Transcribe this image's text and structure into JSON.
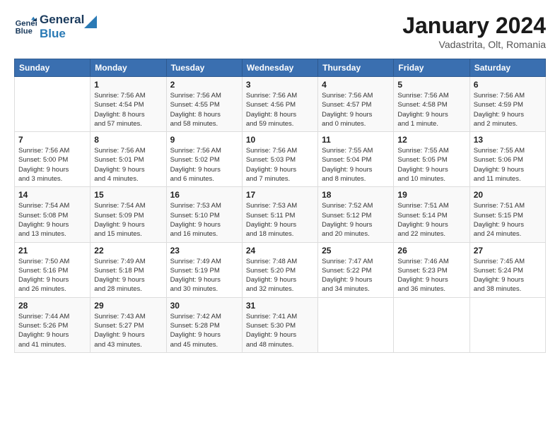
{
  "logo": {
    "line1": "General",
    "line2": "Blue"
  },
  "title": "January 2024",
  "subtitle": "Vadastrita, Olt, Romania",
  "header": {
    "days": [
      "Sunday",
      "Monday",
      "Tuesday",
      "Wednesday",
      "Thursday",
      "Friday",
      "Saturday"
    ]
  },
  "weeks": [
    [
      {
        "day": "",
        "info": ""
      },
      {
        "day": "1",
        "info": "Sunrise: 7:56 AM\nSunset: 4:54 PM\nDaylight: 8 hours\nand 57 minutes."
      },
      {
        "day": "2",
        "info": "Sunrise: 7:56 AM\nSunset: 4:55 PM\nDaylight: 8 hours\nand 58 minutes."
      },
      {
        "day": "3",
        "info": "Sunrise: 7:56 AM\nSunset: 4:56 PM\nDaylight: 8 hours\nand 59 minutes."
      },
      {
        "day": "4",
        "info": "Sunrise: 7:56 AM\nSunset: 4:57 PM\nDaylight: 9 hours\nand 0 minutes."
      },
      {
        "day": "5",
        "info": "Sunrise: 7:56 AM\nSunset: 4:58 PM\nDaylight: 9 hours\nand 1 minute."
      },
      {
        "day": "6",
        "info": "Sunrise: 7:56 AM\nSunset: 4:59 PM\nDaylight: 9 hours\nand 2 minutes."
      }
    ],
    [
      {
        "day": "7",
        "info": "Sunrise: 7:56 AM\nSunset: 5:00 PM\nDaylight: 9 hours\nand 3 minutes."
      },
      {
        "day": "8",
        "info": "Sunrise: 7:56 AM\nSunset: 5:01 PM\nDaylight: 9 hours\nand 4 minutes."
      },
      {
        "day": "9",
        "info": "Sunrise: 7:56 AM\nSunset: 5:02 PM\nDaylight: 9 hours\nand 6 minutes."
      },
      {
        "day": "10",
        "info": "Sunrise: 7:56 AM\nSunset: 5:03 PM\nDaylight: 9 hours\nand 7 minutes."
      },
      {
        "day": "11",
        "info": "Sunrise: 7:55 AM\nSunset: 5:04 PM\nDaylight: 9 hours\nand 8 minutes."
      },
      {
        "day": "12",
        "info": "Sunrise: 7:55 AM\nSunset: 5:05 PM\nDaylight: 9 hours\nand 10 minutes."
      },
      {
        "day": "13",
        "info": "Sunrise: 7:55 AM\nSunset: 5:06 PM\nDaylight: 9 hours\nand 11 minutes."
      }
    ],
    [
      {
        "day": "14",
        "info": "Sunrise: 7:54 AM\nSunset: 5:08 PM\nDaylight: 9 hours\nand 13 minutes."
      },
      {
        "day": "15",
        "info": "Sunrise: 7:54 AM\nSunset: 5:09 PM\nDaylight: 9 hours\nand 15 minutes."
      },
      {
        "day": "16",
        "info": "Sunrise: 7:53 AM\nSunset: 5:10 PM\nDaylight: 9 hours\nand 16 minutes."
      },
      {
        "day": "17",
        "info": "Sunrise: 7:53 AM\nSunset: 5:11 PM\nDaylight: 9 hours\nand 18 minutes."
      },
      {
        "day": "18",
        "info": "Sunrise: 7:52 AM\nSunset: 5:12 PM\nDaylight: 9 hours\nand 20 minutes."
      },
      {
        "day": "19",
        "info": "Sunrise: 7:51 AM\nSunset: 5:14 PM\nDaylight: 9 hours\nand 22 minutes."
      },
      {
        "day": "20",
        "info": "Sunrise: 7:51 AM\nSunset: 5:15 PM\nDaylight: 9 hours\nand 24 minutes."
      }
    ],
    [
      {
        "day": "21",
        "info": "Sunrise: 7:50 AM\nSunset: 5:16 PM\nDaylight: 9 hours\nand 26 minutes."
      },
      {
        "day": "22",
        "info": "Sunrise: 7:49 AM\nSunset: 5:18 PM\nDaylight: 9 hours\nand 28 minutes."
      },
      {
        "day": "23",
        "info": "Sunrise: 7:49 AM\nSunset: 5:19 PM\nDaylight: 9 hours\nand 30 minutes."
      },
      {
        "day": "24",
        "info": "Sunrise: 7:48 AM\nSunset: 5:20 PM\nDaylight: 9 hours\nand 32 minutes."
      },
      {
        "day": "25",
        "info": "Sunrise: 7:47 AM\nSunset: 5:22 PM\nDaylight: 9 hours\nand 34 minutes."
      },
      {
        "day": "26",
        "info": "Sunrise: 7:46 AM\nSunset: 5:23 PM\nDaylight: 9 hours\nand 36 minutes."
      },
      {
        "day": "27",
        "info": "Sunrise: 7:45 AM\nSunset: 5:24 PM\nDaylight: 9 hours\nand 38 minutes."
      }
    ],
    [
      {
        "day": "28",
        "info": "Sunrise: 7:44 AM\nSunset: 5:26 PM\nDaylight: 9 hours\nand 41 minutes."
      },
      {
        "day": "29",
        "info": "Sunrise: 7:43 AM\nSunset: 5:27 PM\nDaylight: 9 hours\nand 43 minutes."
      },
      {
        "day": "30",
        "info": "Sunrise: 7:42 AM\nSunset: 5:28 PM\nDaylight: 9 hours\nand 45 minutes."
      },
      {
        "day": "31",
        "info": "Sunrise: 7:41 AM\nSunset: 5:30 PM\nDaylight: 9 hours\nand 48 minutes."
      },
      {
        "day": "",
        "info": ""
      },
      {
        "day": "",
        "info": ""
      },
      {
        "day": "",
        "info": ""
      }
    ]
  ]
}
